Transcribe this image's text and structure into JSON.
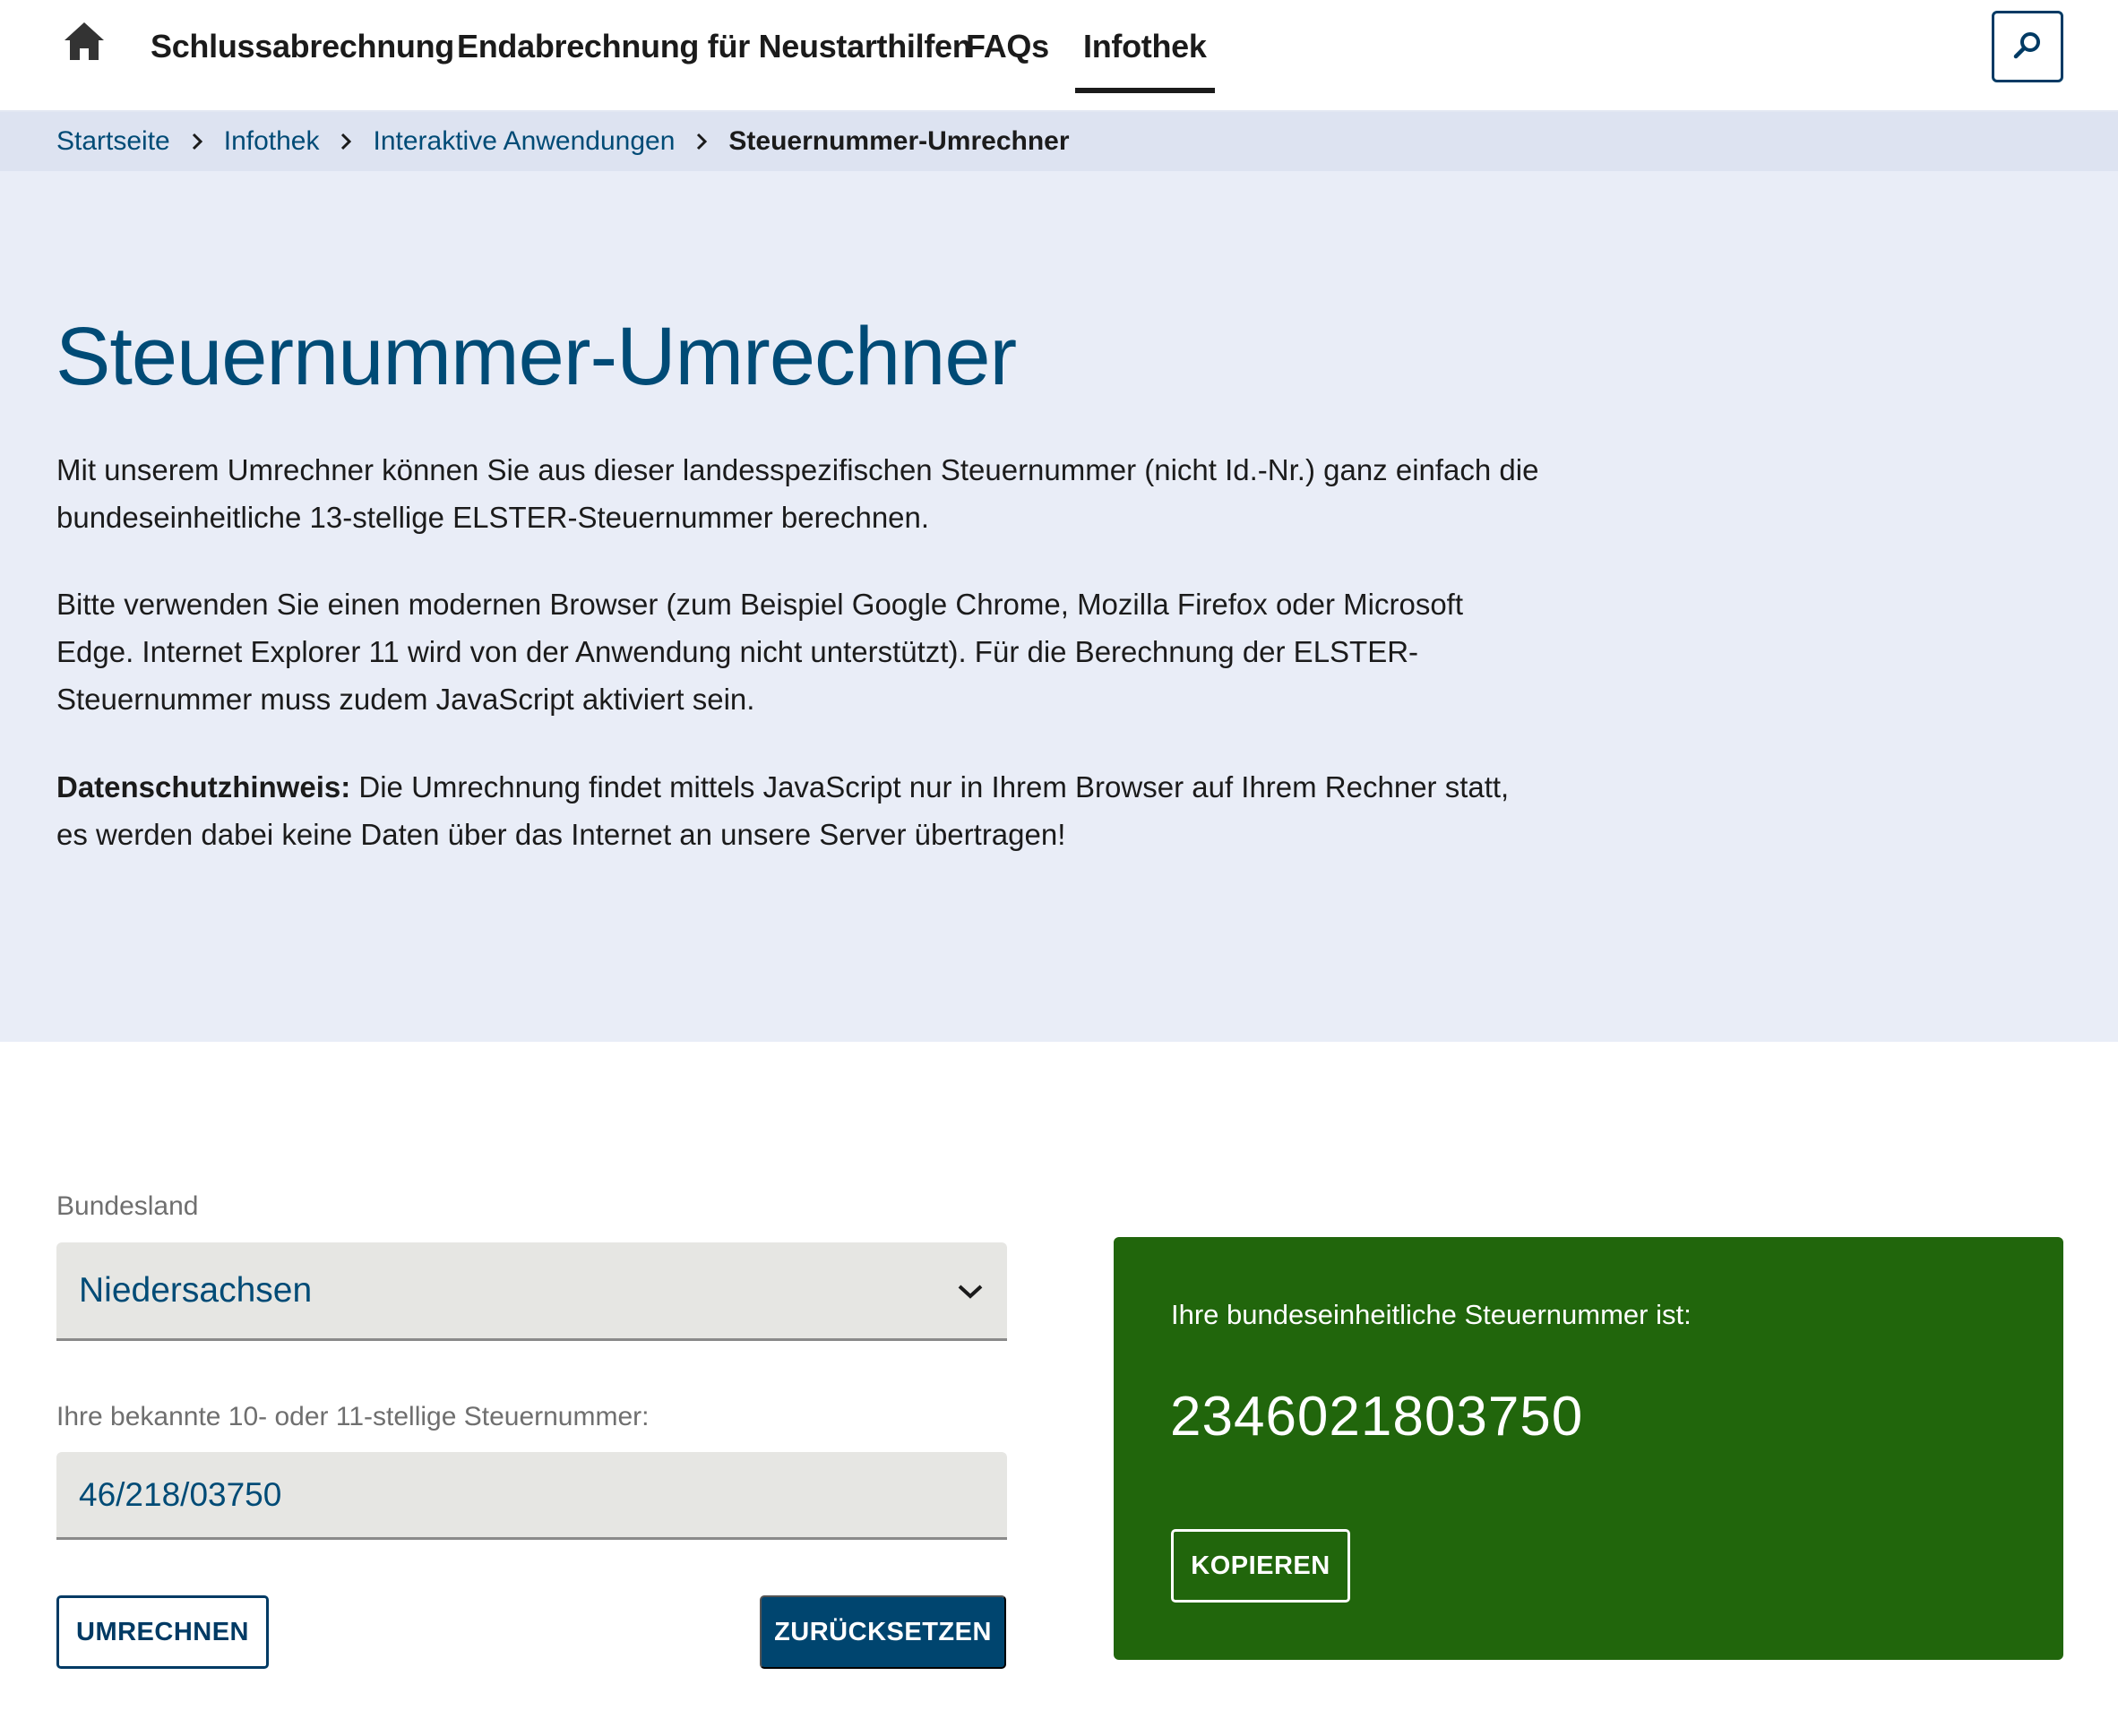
{
  "nav": {
    "home_icon": "home-icon",
    "items": [
      {
        "label": "Schlussabrechnung"
      },
      {
        "label": "Endabrechnung für Neustarthilfen"
      },
      {
        "label": "FAQs"
      },
      {
        "label": "Infothek",
        "active": true
      }
    ],
    "search_icon": "search-icon"
  },
  "breadcrumb": {
    "items": [
      "Startseite",
      "Infothek",
      "Interaktive Anwendungen"
    ],
    "current": "Steuernummer-Umrechner",
    "separator_icon": "chevron-right-icon"
  },
  "hero": {
    "title": "Steuernummer-Umrechner",
    "paragraph1": "Mit unserem Umrechner können Sie aus dieser landesspezifischen Steuernummer (nicht Id.-Nr.) ganz einfach die bundeseinheitliche 13-stellige ELSTER-Steuernummer berechnen.",
    "paragraph2": "Bitte verwenden Sie einen modernen Browser (zum Beispiel Google Chrome, Mozilla Firefox oder Microsoft Edge. Internet Explorer 11 wird von der Anwendung nicht unterstützt). Für die Berechnung der ELSTER-Steuernummer muss zudem JavaScript aktiviert sein.",
    "privacy_label": "Datenschutzhinweis:",
    "privacy_text": " Die Umrechnung findet mittels JavaScript nur in Ihrem Browser auf Ihrem Rechner statt, es werden dabei keine Daten über das Internet an unsere Server übertragen!"
  },
  "form": {
    "state_label": "Bundesland",
    "state_value": "Niedersachsen",
    "taxnumber_label": "Ihre bekannte 10- oder 11-stellige Steuernummer:",
    "taxnumber_value": "46/218/03750",
    "convert_button": "UMRECHNEN",
    "reset_button": "ZURÜCKSETZEN"
  },
  "result": {
    "label": "Ihre bundeseinheitliche Steuernummer ist:",
    "number": "2346021803750",
    "copy_button": "KOPIEREN"
  },
  "colors": {
    "primary": "#004b76",
    "result_bg": "#21660c",
    "breadcrumb_bg": "#dde3f1",
    "hero_bg": "#e9edf7",
    "input_bg": "#e6e6e3"
  }
}
